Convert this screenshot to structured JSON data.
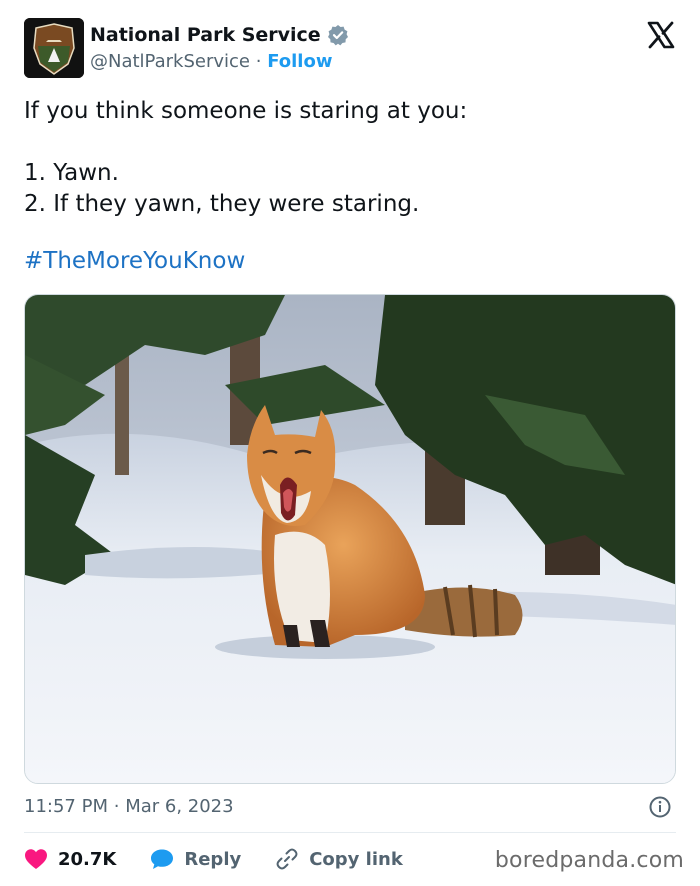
{
  "account": {
    "display_name": "National Park Service",
    "handle": "@NatlParkService",
    "separator": "·",
    "follow_label": "Follow"
  },
  "tweet": {
    "line1": "If you think someone is staring at you:",
    "line2": "1. Yawn.",
    "line3": "2. If they yawn, they were staring.",
    "hashtag": "#TheMoreYouKnow"
  },
  "meta": {
    "time": "11:57 PM",
    "separator": "·",
    "date": "Mar 6, 2023"
  },
  "actions": {
    "like_count": "20.7K",
    "reply_label": "Reply",
    "copy_label": "Copy link"
  },
  "watermark": "boredpanda.com",
  "icons": {
    "verified": "verified-badge-icon",
    "x_logo": "x-logo-icon",
    "info": "info-icon",
    "like": "heart-icon",
    "reply": "speech-bubble-icon",
    "copy": "link-icon"
  },
  "colors": {
    "link_blue": "#1d9bf0",
    "hashtag_blue": "#1d72c4",
    "like_red": "#f91880",
    "text_gray": "#536471"
  }
}
